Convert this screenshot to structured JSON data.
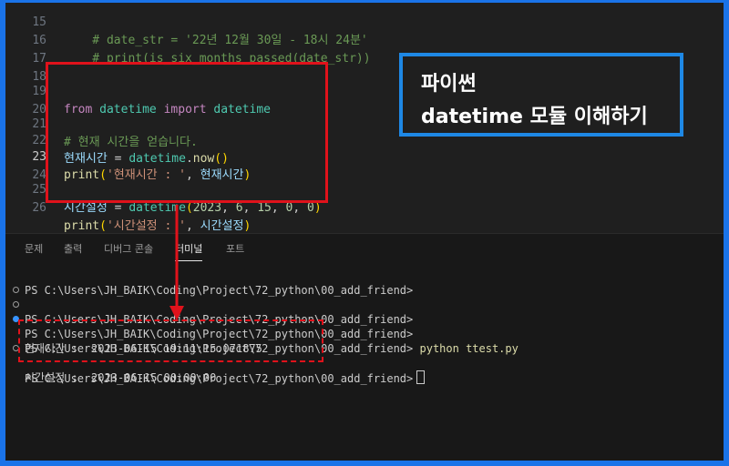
{
  "editor": {
    "lines": [
      {
        "num": "15",
        "text": "    # date_str = '22년 12월 30일 - 18시 24분'"
      },
      {
        "num": "16",
        "text": "    # print(is_six_months_passed(date_str))"
      },
      {
        "num": "17",
        "text": ""
      },
      {
        "num": "18",
        "text": ""
      },
      {
        "num": "19",
        "from": "from",
        "module": "datetime",
        "import": "import",
        "cls": "datetime"
      },
      {
        "num": "20",
        "text": ""
      },
      {
        "num": "21",
        "comment": "# 현재 시간을 얻습니다."
      },
      {
        "num": "22",
        "var": "현재시간",
        "eq": " = ",
        "obj": "datetime",
        "dot": ".",
        "fn": "now",
        "paren": "()"
      },
      {
        "num": "23",
        "fn": "print",
        "open": "(",
        "str": "'현재시간 : '",
        "comma": ", ",
        "var": "현재시간",
        "close": ")"
      },
      {
        "num": "24",
        "text": ""
      },
      {
        "num": "25",
        "var": "시간설정",
        "eq": " = ",
        "fn": "datetime",
        "open": "(",
        "args": [
          "2023",
          "6",
          "15",
          "0",
          "0"
        ],
        "close": ")"
      },
      {
        "num": "26",
        "fn": "print",
        "open": "(",
        "str": "'시간설정 : '",
        "comma": ", ",
        "var": "시간설정",
        "close": ")"
      }
    ]
  },
  "title_box": {
    "line1": "파이썬",
    "line2": "datetime 모듈 이해하기"
  },
  "panel": {
    "tabs": [
      "문제",
      "출력",
      "디버그 콘솔",
      "터미널",
      "포트"
    ],
    "active_tab": "터미널"
  },
  "terminal": {
    "lines": [
      {
        "text": "PS C:\\Users\\JH_BAIK\\Coding\\Project\\72_python\\00_add_friend>",
        "marker": "none"
      },
      {
        "text": "PS C:\\Users\\JH_BAIK\\Coding\\Project\\72_python\\00_add_friend>",
        "marker": "hollow"
      },
      {
        "text": "PS C:\\Users\\JH_BAIK\\Coding\\Project\\72_python\\00_add_friend>",
        "marker": "hollow"
      },
      {
        "text": "PS C:\\Users\\JH_BAIK\\Coding\\Project\\72_python\\00_add_friend>",
        "command": " python ttest.py",
        "marker": "filled"
      },
      {
        "text": "현재시간 :  2023-06-15 19:11:15.071875",
        "marker": "none"
      },
      {
        "text": "시간설정 :  2023-06-15 00:00:00",
        "marker": "hollow"
      },
      {
        "text": "PS C:\\Users\\JH_BAIK\\Coding\\Project\\72_python\\00_add_friend>",
        "marker": "none",
        "cursor": true
      }
    ]
  },
  "colors": {
    "annotation_red": "#e0121b",
    "annotation_blue": "#1e88e5",
    "frame_blue": "#1a73e8"
  }
}
